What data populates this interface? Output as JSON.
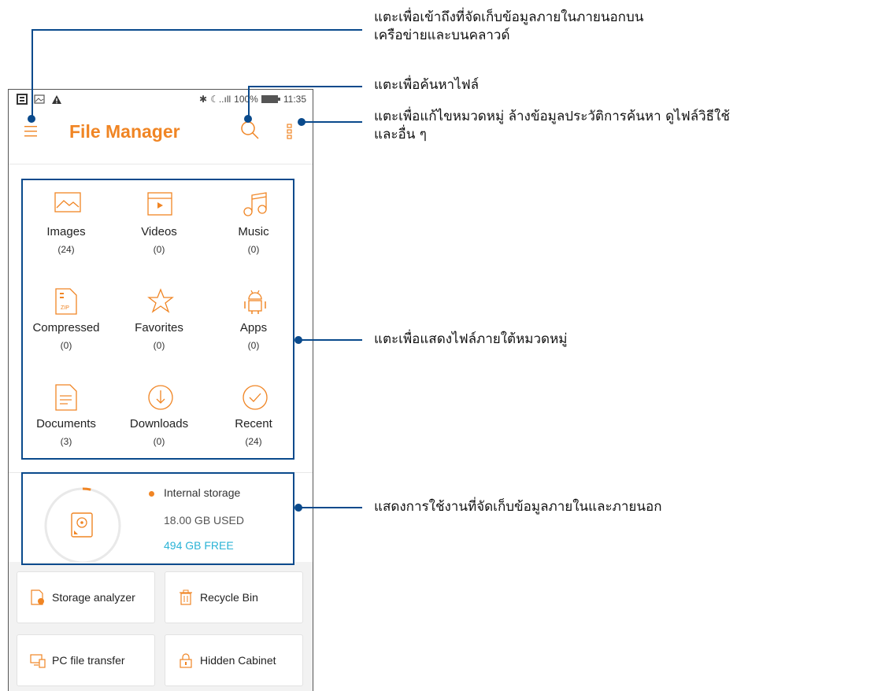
{
  "status_bar": {
    "percent": "100%",
    "time": "11:35"
  },
  "app_bar": {
    "title": "File Manager"
  },
  "categories": [
    {
      "label": "Images",
      "count": "(24)",
      "icon": "image-icon"
    },
    {
      "label": "Videos",
      "count": "(0)",
      "icon": "video-icon"
    },
    {
      "label": "Music",
      "count": "(0)",
      "icon": "music-icon"
    },
    {
      "label": "Compressed",
      "count": "(0)",
      "icon": "zip-file-icon"
    },
    {
      "label": "Favorites",
      "count": "(0)",
      "icon": "star-icon"
    },
    {
      "label": "Apps",
      "count": "(0)",
      "icon": "android-icon"
    },
    {
      "label": "Documents",
      "count": "(3)",
      "icon": "document-icon"
    },
    {
      "label": "Downloads",
      "count": "(0)",
      "icon": "download-icon"
    },
    {
      "label": "Recent",
      "count": "(24)",
      "icon": "check-circle-icon"
    }
  ],
  "zip_label": "ZIP",
  "storage": {
    "name": "Internal storage",
    "used": "18.00 GB USED",
    "free": "494 GB FREE",
    "used_fraction": 0.035
  },
  "tools": [
    {
      "label": "Storage analyzer",
      "icon": "storage-analyzer-icon"
    },
    {
      "label": "Recycle Bin",
      "icon": "recycle-bin-icon"
    },
    {
      "label": "PC file transfer",
      "icon": "pc-transfer-icon"
    },
    {
      "label": "Hidden Cabinet",
      "icon": "lock-icon"
    }
  ],
  "callouts": {
    "menu_line1": "แตะเพื่อเข้าถึงที่จัดเก็บข้อมูลภายในภายนอกบน",
    "menu_line2": "เครือข่ายและบนคลาวด์",
    "search": "แตะเพื่อค้นหาไฟล์",
    "more_line1": "แตะเพื่อแก้ไขหมวดหมู่ ล้างข้อมูลประวัติการค้นหา ดูไฟล์วิธีใช้",
    "more_line2": "และอื่น ๆ",
    "categories": "แตะเพื่อแสดงไฟล์ภายใต้หมวดหมู่",
    "storage": "แสดงการใช้งานที่จัดเก็บข้อมูลภายในและภายนอก"
  },
  "colors": {
    "accent": "#f08524",
    "free_text": "#2bb3d6",
    "callout": "#0a4a8c"
  }
}
